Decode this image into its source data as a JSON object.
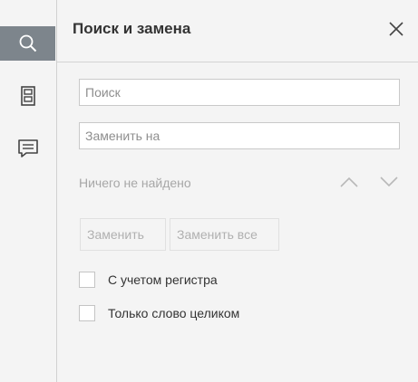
{
  "sidebar": {
    "items": [
      {
        "icon": "search-icon",
        "active": true
      },
      {
        "icon": "pages-icon",
        "active": false
      },
      {
        "icon": "comment-icon",
        "active": false
      }
    ],
    "active_color": "#7d858c"
  },
  "panel": {
    "title": "Поиск и замена",
    "search": {
      "placeholder": "Поиск",
      "value": ""
    },
    "replace": {
      "placeholder": "Заменить на",
      "value": ""
    },
    "status": "Ничего не найдено",
    "buttons": {
      "replace": "Заменить",
      "replace_all": "Заменить все"
    },
    "options": [
      {
        "label": "С учетом регистра",
        "checked": false
      },
      {
        "label": "Только слово целиком",
        "checked": false
      }
    ]
  }
}
